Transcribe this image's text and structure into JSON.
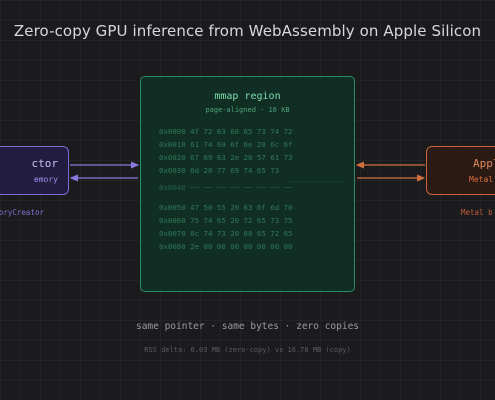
{
  "title": "Zero-copy GPU inference from WebAssembly on Apple Silicon",
  "left_node": {
    "name": "ctor",
    "sub": "emory",
    "caption": "oryCreator",
    "color": "#7b6cd6"
  },
  "right_node": {
    "name": "Appl",
    "sub": "Metal",
    "caption": "Metal b",
    "color": "#c8663a"
  },
  "mmap": {
    "title": "mmap region",
    "subtitle": "page-aligned · 16 KB",
    "color": "#2f8a63",
    "rows": [
      "0x0000 4f 72 63 68 65 73 74 72",
      "0x0010 61 74 69 6f 6e 20 6c 6f",
      "0x0020 67 69 63 2e 20 57 61 73",
      "0x0030 6d 20 77 69 74 65 73",
      "0x0040 ── ── ── ── ── ── ── ──",
      "0x0050 47 50 55 20 63 6f 6d 70",
      "0x0060 75 74 65 20 72 65 73 75",
      "0x0070 6c 74 73 20 68 65 72 65",
      "0x0080 2e 00 00 00 00 00 00 00"
    ]
  },
  "footer": {
    "line1": "same pointer · same bytes · zero copies",
    "line2": "RSS delta: 0.03 MB (zero-copy) vs 16.78 MB (copy)"
  }
}
